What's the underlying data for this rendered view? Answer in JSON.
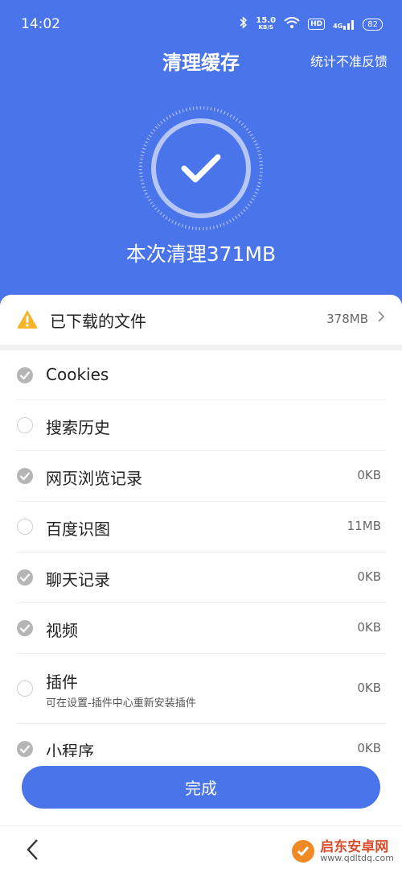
{
  "status_bar": {
    "time": "14:02",
    "net_speed_value": "15.0",
    "net_speed_unit": "KB/S",
    "hd_label": "HD",
    "network_label": "4G",
    "battery": "82"
  },
  "header": {
    "title": "清理缓存",
    "feedback": "统计不准反馈",
    "result": "本次清理371MB"
  },
  "downloads": {
    "label": "已下载的文件",
    "size": "378MB"
  },
  "items": [
    {
      "label": "Cookies",
      "size": "",
      "sub": "",
      "checked": true
    },
    {
      "label": "搜索历史",
      "size": "",
      "sub": "",
      "checked": false
    },
    {
      "label": "网页浏览记录",
      "size": "0KB",
      "sub": "",
      "checked": true
    },
    {
      "label": "百度识图",
      "size": "11MB",
      "sub": "",
      "checked": false
    },
    {
      "label": "聊天记录",
      "size": "0KB",
      "sub": "",
      "checked": true
    },
    {
      "label": "视频",
      "size": "0KB",
      "sub": "",
      "checked": true
    },
    {
      "label": "插件",
      "size": "0KB",
      "sub": "可在设置-插件中心重新安装插件",
      "checked": false
    },
    {
      "label": "小程序",
      "size": "0KB",
      "sub": "",
      "checked": true
    }
  ],
  "done_button": "完成",
  "watermark": {
    "name": "启东安卓网",
    "url": "www.qdltdq.com"
  },
  "colors": {
    "accent": "#4a74ea",
    "warning": "#f5b52a",
    "checked_gray": "#b5b5b5"
  }
}
